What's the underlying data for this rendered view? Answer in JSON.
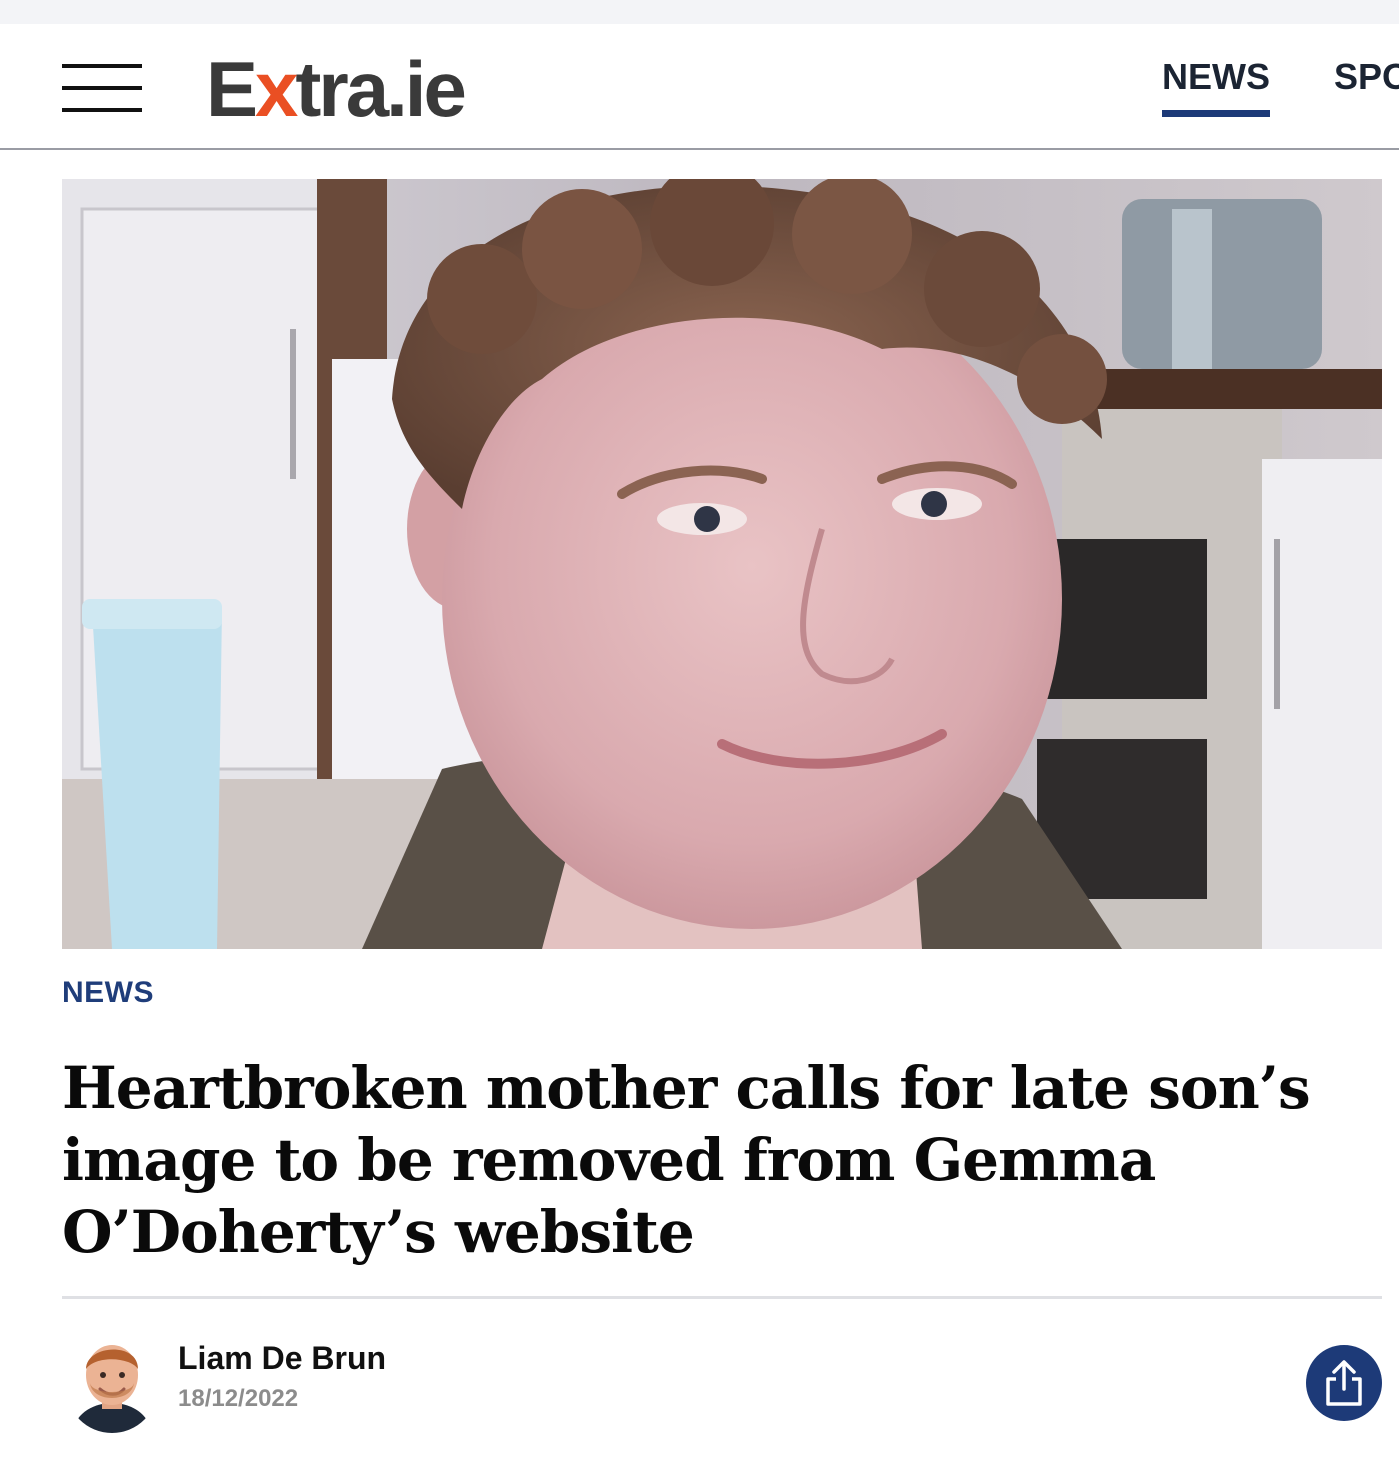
{
  "header": {
    "logo": {
      "part1": "E",
      "part2": "x",
      "part3": "tra.ie"
    },
    "nav": [
      {
        "label": "NEWS",
        "active": true
      },
      {
        "label": "SPO",
        "active": false
      }
    ]
  },
  "hero": {
    "icon": "photo-of-young-man-in-kitchen"
  },
  "article": {
    "category": "NEWS",
    "headline": "Heartbroken mother calls for late son’s image to be removed from Gemma O’Doherty’s website",
    "author": "Liam De Brun",
    "date": "18/12/2022"
  },
  "colors": {
    "brand_navy": "#1d3a78",
    "logo_orange": "#ea4f23",
    "logo_gray": "#3a3a3a"
  }
}
